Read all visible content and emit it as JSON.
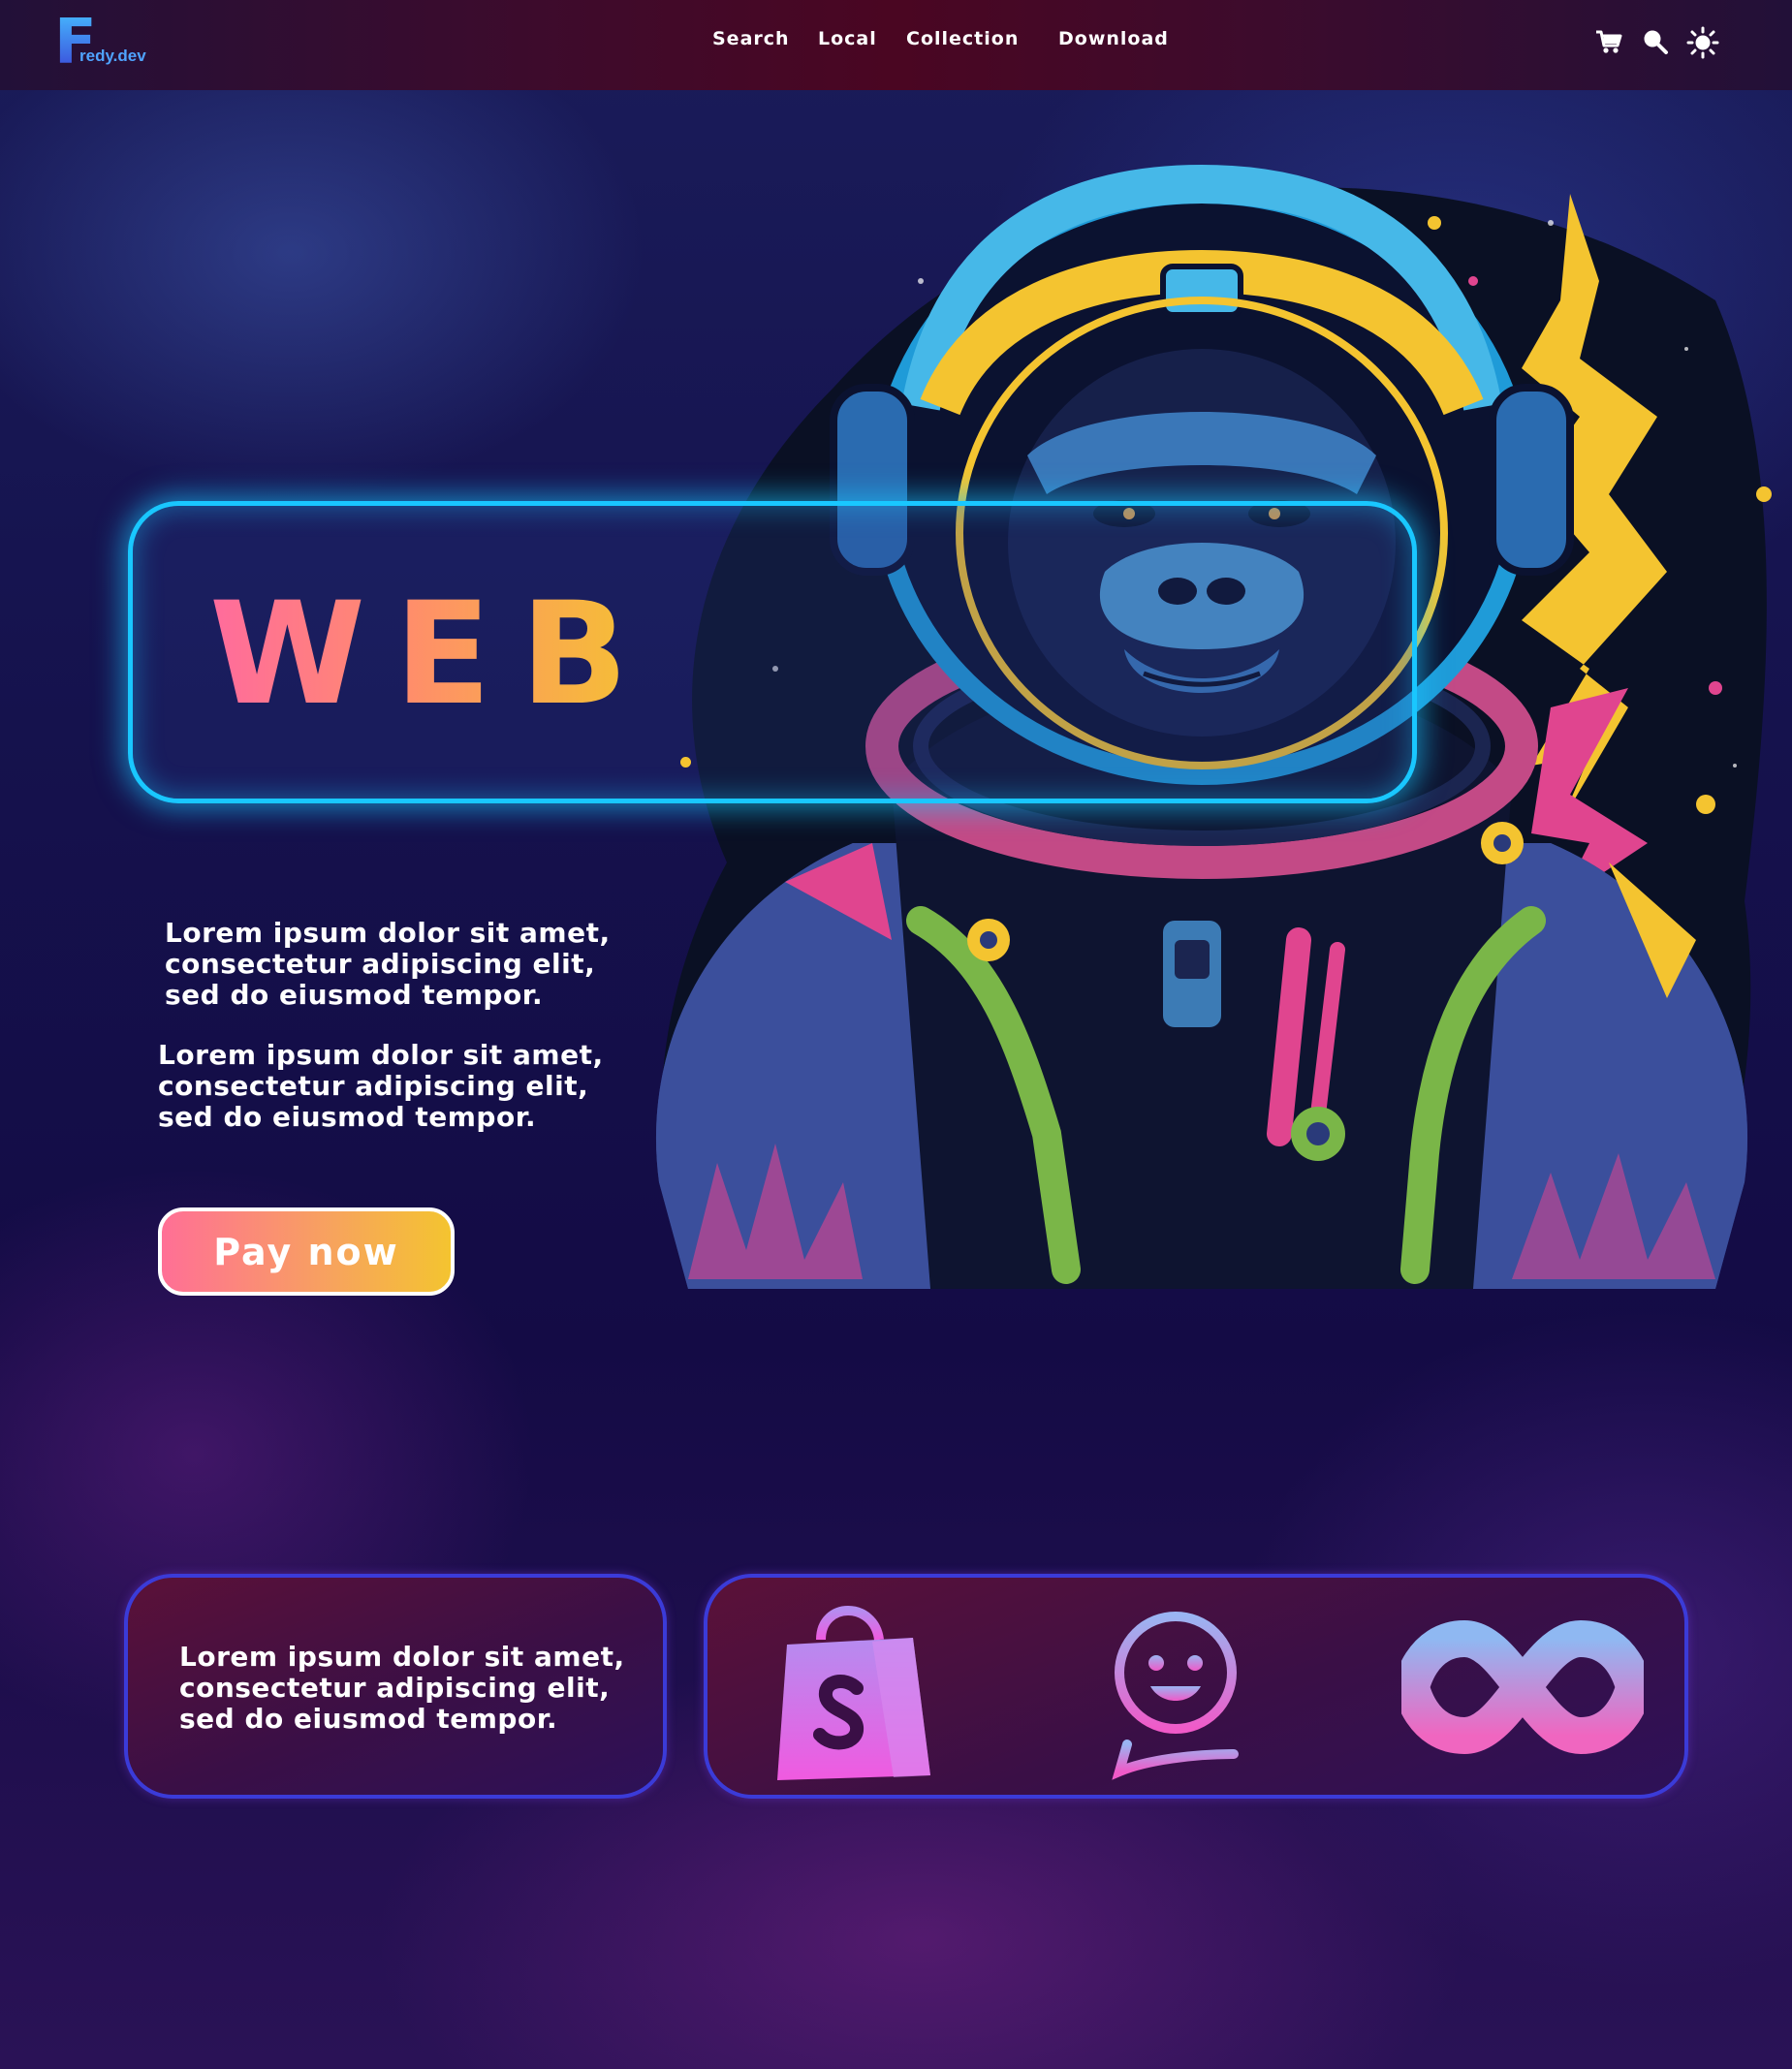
{
  "brand": {
    "logo_letter": "F",
    "logo_text": "redy.dev"
  },
  "nav": {
    "items": [
      {
        "label": "Search"
      },
      {
        "label": "Local"
      },
      {
        "label": "Collection"
      },
      {
        "label": "Download"
      }
    ]
  },
  "toolbar_icons": [
    "cart-icon",
    "search-icon",
    "sun-icon"
  ],
  "hero": {
    "title": "WEB",
    "paragraph1": [
      "Lorem ipsum dolor sit amet,",
      "consectetur adipiscing elit,",
      "sed do eiusmod tempor."
    ],
    "paragraph2": [
      "Lorem ipsum dolor sit amet,",
      "consectetur adipiscing elit,",
      "sed do eiusmod tempor."
    ],
    "cta_label": "Pay now",
    "image": "astronaut-gorilla-illustration"
  },
  "bottom": {
    "card_text": [
      "Lorem ipsum dolor sit amet,",
      "consectetur adipiscing elit,",
      "sed do eiusmod tempor."
    ],
    "icons": [
      "shopify-bag-icon",
      "chat-smiley-icon",
      "infinity-icon"
    ]
  },
  "colors": {
    "accent_cyan": "#19c7ff",
    "gradient_pink": "#ff6b9d",
    "gradient_yellow": "#f4c430",
    "card_border": "#3b3bd8"
  }
}
